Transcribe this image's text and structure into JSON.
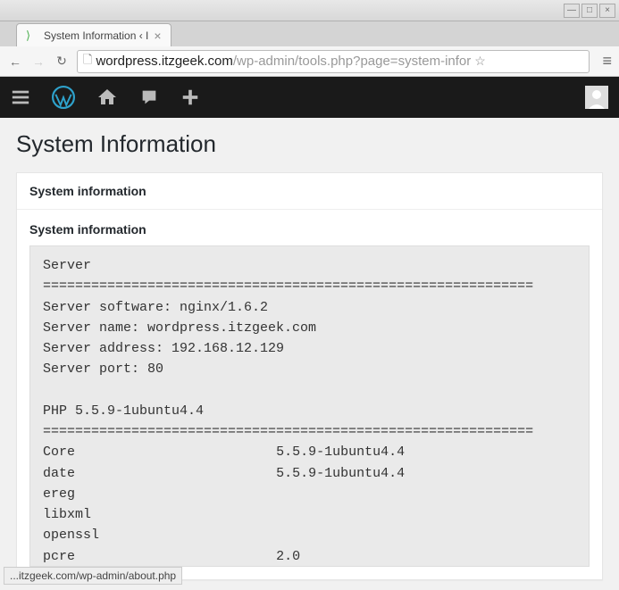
{
  "window": {
    "minimize": "—",
    "maximize": "□",
    "close": "×"
  },
  "tab": {
    "title": "System Information ‹ I",
    "close": "×"
  },
  "nav": {
    "back": "←",
    "forward": "→",
    "reload": "↻",
    "url_host": "wordpress.itzgeek.com",
    "url_path": "/wp-admin/tools.php?page=system-infor",
    "hamburger": "≡"
  },
  "page": {
    "title": "System Information",
    "metabox_title": "System information",
    "section_title": "System information"
  },
  "sysinfo": {
    "server_header": "Server",
    "divider": "=============================================================",
    "server_software_label": "Server software: ",
    "server_software_value": "nginx/1.6.2",
    "server_name_label": "Server name: ",
    "server_name_value": "wordpress.itzgeek.com",
    "server_address_label": "Server address: ",
    "server_address_value": "192.168.12.129",
    "server_port_label": "Server port: ",
    "server_port_value": "80",
    "php_header": "PHP 5.5.9-1ubuntu4.4",
    "ext_core": "Core",
    "ext_core_ver": "5.5.9-1ubuntu4.4",
    "ext_date": "date",
    "ext_date_ver": "5.5.9-1ubuntu4.4",
    "ext_ereg": "ereg",
    "ext_libxml": "libxml",
    "ext_openssl": "openssl",
    "ext_pcre": "pcre",
    "ext_pcre_ver": "2.0"
  },
  "status_bar": "...itzgeek.com/wp-admin/about.php"
}
